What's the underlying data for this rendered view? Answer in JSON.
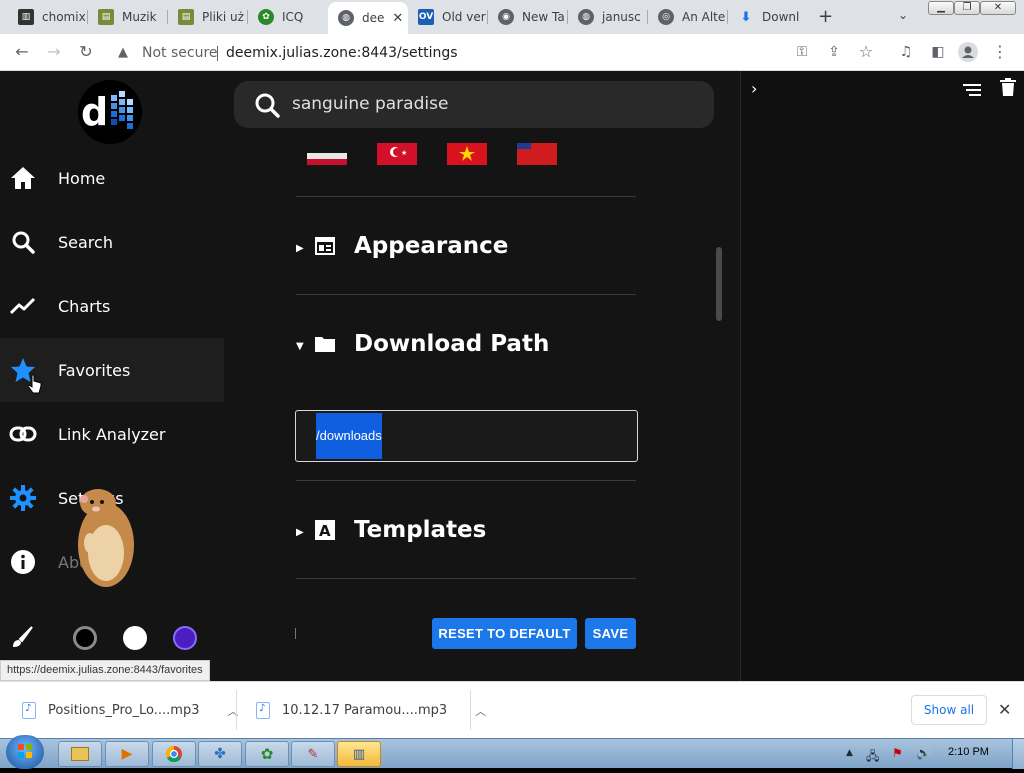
{
  "browser": {
    "tabs": [
      {
        "label": "chomix",
        "icon": "chomikuj-icon",
        "color": "#333333"
      },
      {
        "label": "Muzik",
        "icon": "folder-icon",
        "color": "#7a8a3a"
      },
      {
        "label": "Pliki uż",
        "icon": "folder-icon",
        "color": "#7a8a3a"
      },
      {
        "label": "ICQ",
        "icon": "icq-icon",
        "color": "#2a8a2a"
      },
      {
        "label": "dee",
        "icon": "globe-icon",
        "color": "#5f6368"
      },
      {
        "label": "Old ver",
        "icon": "ov-icon",
        "color": "#1a5fb4"
      },
      {
        "label": "New Ta",
        "icon": "chrome-icon",
        "color": "#5f6368"
      },
      {
        "label": "janusc",
        "icon": "globe-icon",
        "color": "#5f6368"
      },
      {
        "label": "An Alte",
        "icon": "disc-icon",
        "color": "#5f6368"
      },
      {
        "label": "Downl",
        "icon": "download-icon",
        "color": "#1a73e8"
      }
    ],
    "new_tab": "+",
    "address": {
      "security_label": "Not secure",
      "url": "deemix.julias.zone:8443/settings"
    },
    "status_url": "https://deemix.julias.zone:8443/favorites"
  },
  "sidebar": {
    "items": [
      {
        "label": "Home",
        "icon": "home-icon"
      },
      {
        "label": "Search",
        "icon": "search-icon"
      },
      {
        "label": "Charts",
        "icon": "chart-line-icon"
      },
      {
        "label": "Favorites",
        "icon": "star-icon"
      },
      {
        "label": "Link Analyzer",
        "icon": "link-icon"
      },
      {
        "label": "Settings",
        "icon": "gear-icon"
      },
      {
        "label": "About",
        "icon": "info-icon"
      }
    ],
    "theme_icon": "brush-icon",
    "accent_color": "#1e90ff",
    "themes": [
      "#000000",
      "#ffffff",
      "#4b1fbf"
    ]
  },
  "search": {
    "value": "sanguine paradise"
  },
  "settings": {
    "sections": [
      {
        "title": "Appearance",
        "icon": "layout-icon",
        "expanded": false
      },
      {
        "title": "Download Path",
        "icon": "folder-icon",
        "expanded": true
      },
      {
        "title": "Templates",
        "icon": "letter-a-icon",
        "expanded": false
      }
    ],
    "download_path": "/downloads",
    "reset_label": "RESET TO DEFAULT",
    "save_label": "SAVE"
  },
  "downloads": [
    {
      "name": "Positions_Pro_Lo....mp3"
    },
    {
      "name": "10.12.17 Paramou....mp3"
    }
  ],
  "downloads_show_all": "Show all",
  "taskbar": {
    "clock": "2:10 PM"
  }
}
